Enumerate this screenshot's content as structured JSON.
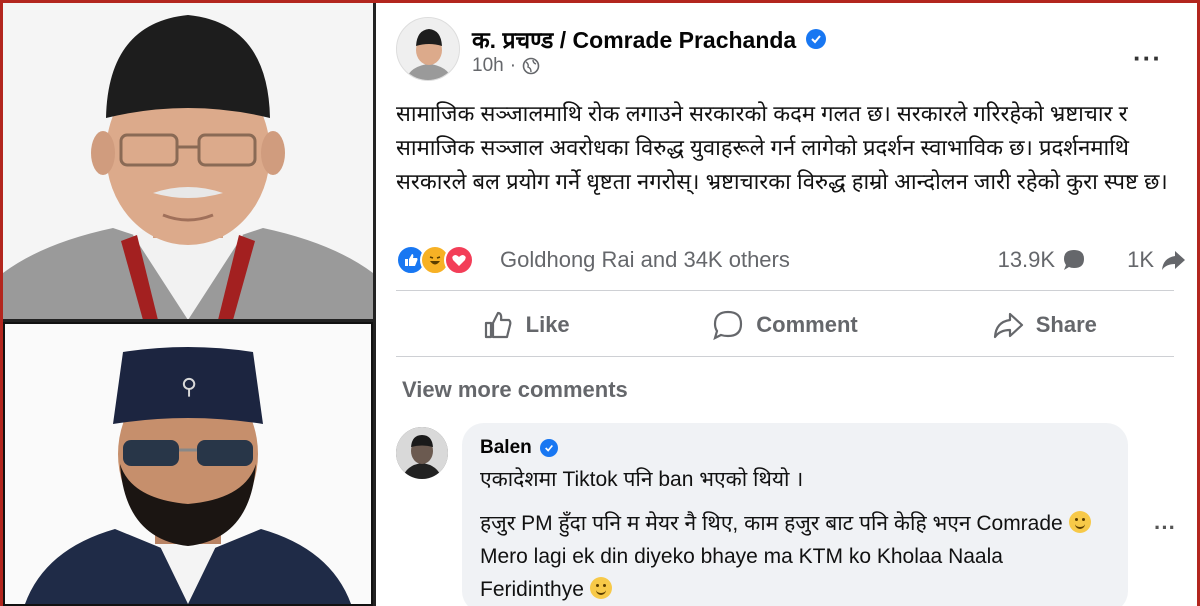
{
  "post": {
    "author": "क. प्रचण्ड / Comrade Prachanda",
    "time": "10h",
    "text": "सामाजिक सञ्जालमाथि रोक लगाउने सरकारको कदम गलत छ। सरकारले गरिरहेको भ्रष्टाचार र सामाजिक सञ्जाल अवरोधका विरुद्ध युवाहरूले गर्न लागेको प्रदर्शन स्वाभाविक छ। प्रदर्शनमाथि सरकारले बल प्रयोग गर्ने धृष्टता नगरोस्। भ्रष्टाचारका विरुद्ध हाम्रो आन्दोलन जारी रहेको कुरा स्पष्ट छ।",
    "reactions_label": "Goldhong Rai and 34K others",
    "comments_count": "13.9K",
    "shares_count": "1K",
    "icons": {
      "verified": "verified-badge-icon",
      "privacy": "globe-icon",
      "more": "more-options-icon",
      "reactions": [
        "like-reaction-icon",
        "haha-reaction-icon",
        "love-reaction-icon"
      ],
      "comment_count": "comment-bubble-icon",
      "share_count": "share-arrow-icon"
    }
  },
  "actions": {
    "like": "Like",
    "comment": "Comment",
    "share": "Share"
  },
  "view_more": "View more comments",
  "comment": {
    "author": "Balen",
    "line1": "एकादेशमा Tiktok पनि ban भएको थियो ।",
    "line2_part1": "हजुर PM हुँदा पनि म मेयर नै थिए, काम हजुर बाट पनि केहि भएन Comrade",
    "line2_part2": "Mero lagi ek din diyeko bhaye ma KTM ko Kholaa Naala Feridinthye"
  },
  "colors": {
    "brand_blue": "#1877f2",
    "frame_red": "#b3261e",
    "muted_text": "#65676b",
    "comment_bg": "#f0f2f5"
  }
}
